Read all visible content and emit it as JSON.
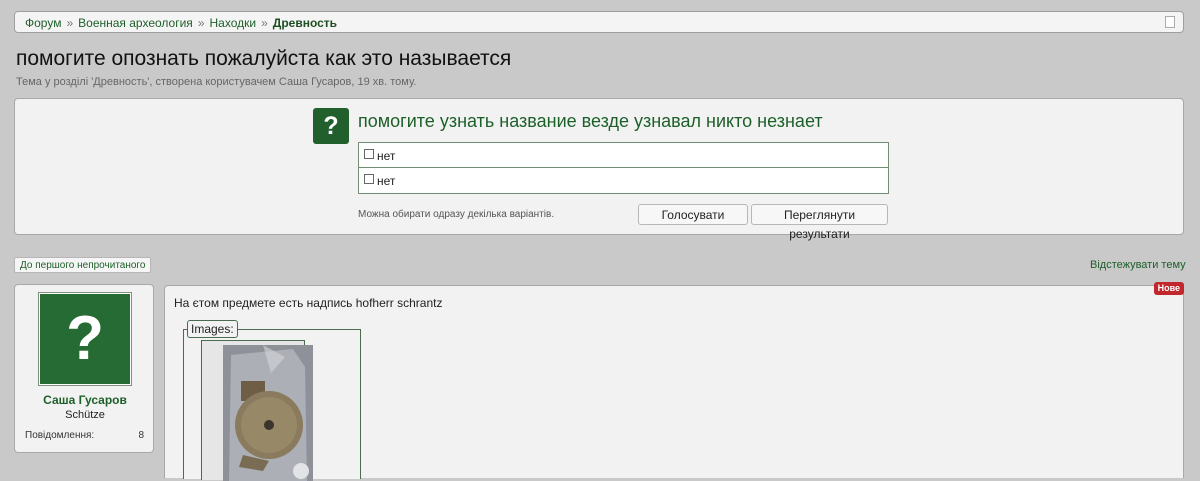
{
  "breadcrumb": {
    "items": [
      "Форум",
      "Военная археология",
      "Находки"
    ],
    "current": "Древность",
    "separator": "»"
  },
  "thread": {
    "title": "помогите опознать пожалуйста как это называется",
    "subtitle": "Тема у розділі 'Древность', створена користувачем Саша Гусаров, 19 хв. тому."
  },
  "poll": {
    "icon": "?",
    "question": "помогите узнать название везде узнавал никто незнает",
    "options": [
      {
        "label": "нет"
      },
      {
        "label": "нет"
      }
    ],
    "note": "Можна обирати одразу декілька варіантів.",
    "vote_label": "Голосувати",
    "results_label": "Переглянути результати"
  },
  "nav": {
    "first_unread": "До першого непрочитаного",
    "watch": "Відстежувати тему"
  },
  "user": {
    "avatar_glyph": "?",
    "name": "Саша Гусаров",
    "rank": "Schütze",
    "messages_label": "Повідомлення:",
    "messages_count": "8"
  },
  "post": {
    "badge": "Нове",
    "text": "На єтом предмете есть надпись hofherr schrantz",
    "images_legend": "Images:"
  },
  "colors": {
    "accent": "#1d5f29",
    "badge": "#c1272d",
    "background": "#c9c9c9"
  }
}
